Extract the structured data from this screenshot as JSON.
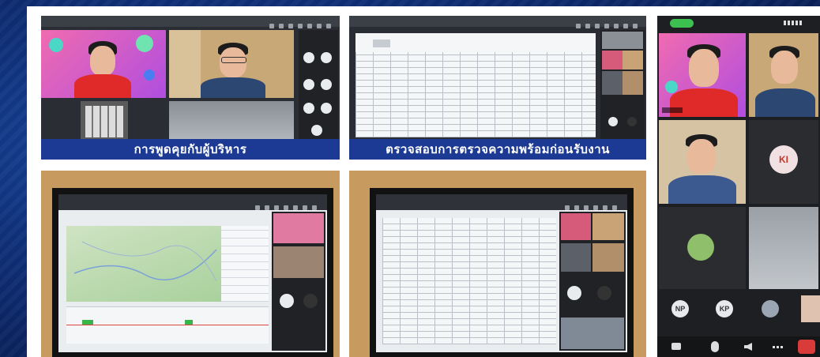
{
  "captions": {
    "top_left": "การพูดคุยกับผู้บริหาร",
    "top_middle": "ตรวจสอบการตรวจความพร้อมก่อนรับงาน"
  },
  "phone": {
    "avatar_initials": "KI",
    "participants": [
      {
        "initials": "NP"
      },
      {
        "initials": "KP"
      }
    ]
  }
}
